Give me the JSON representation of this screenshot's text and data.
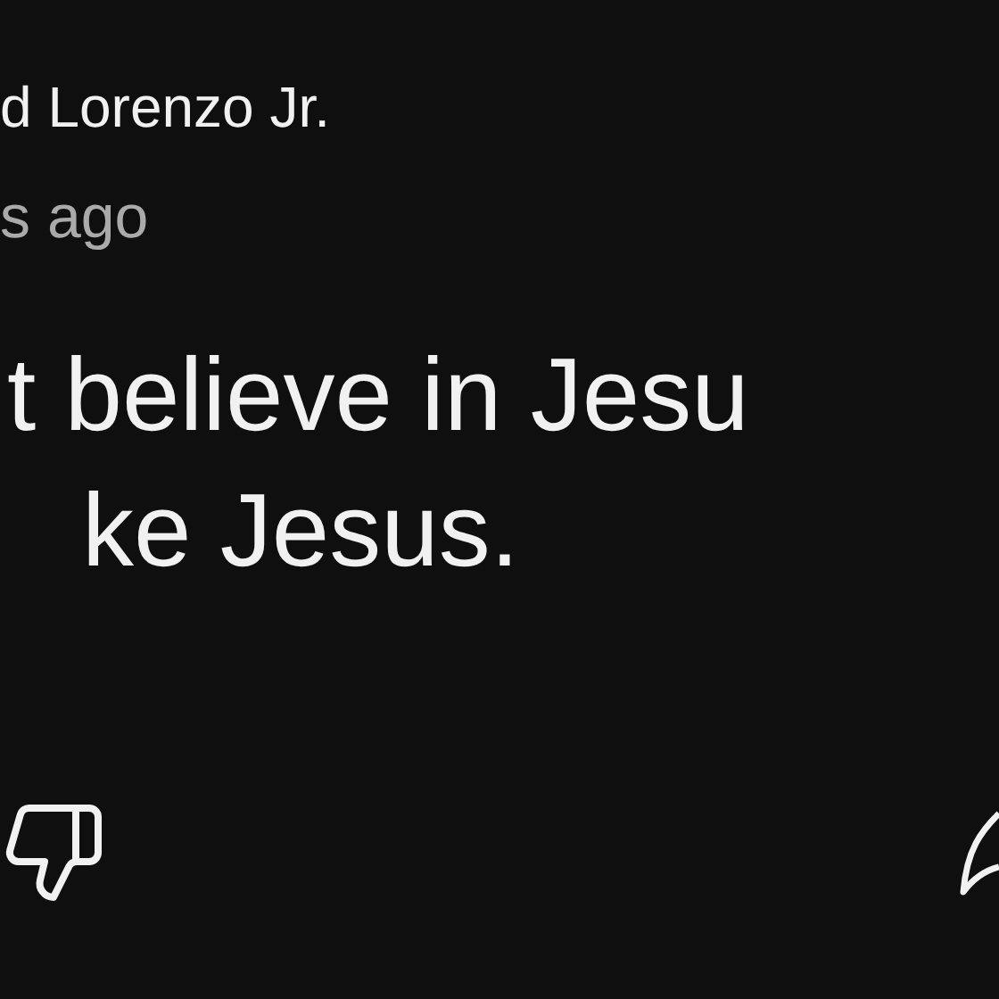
{
  "comment": {
    "author": "d Lorenzo Jr.",
    "time": "s ago",
    "lines": [
      "t believe in Jesu",
      "ke Jesus."
    ]
  }
}
